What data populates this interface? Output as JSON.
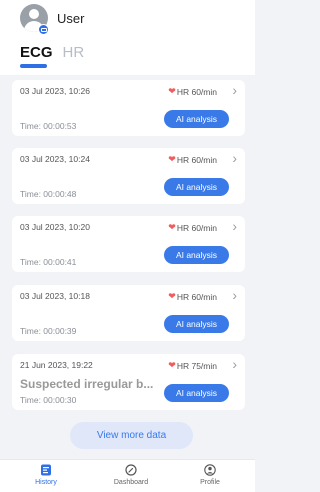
{
  "header": {
    "user_name": "User",
    "tabs": [
      {
        "label": "ECG",
        "active": true
      },
      {
        "label": "HR",
        "active": false
      }
    ]
  },
  "records": [
    {
      "date": "03 Jul 2023, 10:26",
      "hr": "HR 60/min",
      "time": "Time: 00:00:53",
      "status": "",
      "button": "AI analysis"
    },
    {
      "date": "03 Jul 2023, 10:24",
      "hr": "HR 60/min",
      "time": "Time: 00:00:48",
      "status": "",
      "button": "AI analysis"
    },
    {
      "date": "03 Jul 2023, 10:20",
      "hr": "HR 60/min",
      "time": "Time: 00:00:41",
      "status": "",
      "button": "AI analysis"
    },
    {
      "date": "03 Jul 2023, 10:18",
      "hr": "HR 60/min",
      "time": "Time: 00:00:39",
      "status": "",
      "button": "AI analysis"
    },
    {
      "date": "21 Jun 2023, 19:22",
      "hr": "HR 75/min",
      "time": "Time: 00:00:30",
      "status": "Suspected irregular b...",
      "button": "AI analysis"
    }
  ],
  "view_more_label": "View more data",
  "nav": [
    {
      "label": "History",
      "icon": "history-icon",
      "active": true
    },
    {
      "label": "Dashboard",
      "icon": "dashboard-icon",
      "active": false
    },
    {
      "label": "Profile",
      "icon": "profile-icon",
      "active": false
    }
  ],
  "colors": {
    "accent": "#2f6fe6",
    "button": "#3a7ae8",
    "heart": "#f25b5b",
    "background": "#f1f3f7"
  }
}
